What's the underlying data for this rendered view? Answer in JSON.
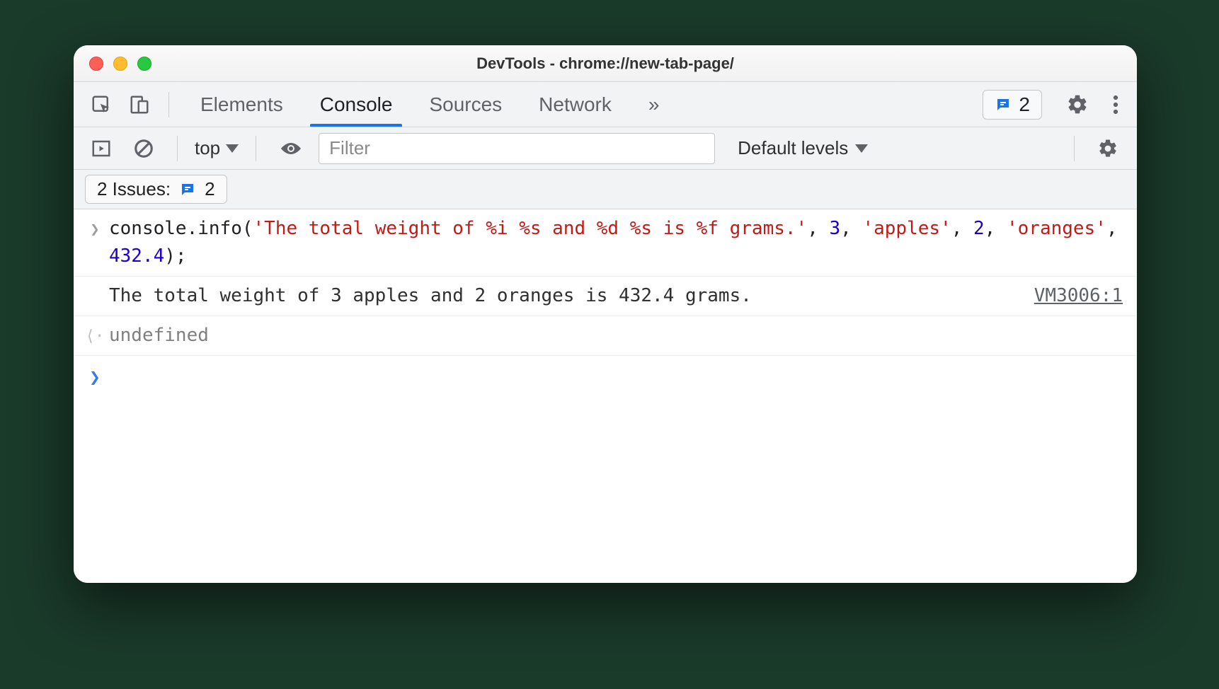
{
  "window": {
    "title": "DevTools - chrome://new-tab-page/"
  },
  "tabs": {
    "items": [
      "Elements",
      "Console",
      "Sources",
      "Network"
    ],
    "active_index": 1,
    "overflow_glyph": "»"
  },
  "header_issues": {
    "count": "2"
  },
  "toolbar": {
    "context": "top",
    "filter_placeholder": "Filter",
    "levels_label": "Default levels"
  },
  "issues_bar": {
    "label": "2 Issues:",
    "count": "2"
  },
  "console": {
    "input": {
      "tokens": [
        {
          "cls": "t-obj",
          "text": "console"
        },
        {
          "cls": "t-obj",
          "text": "."
        },
        {
          "cls": "t-obj",
          "text": "info"
        },
        {
          "cls": "t-obj",
          "text": "("
        },
        {
          "cls": "t-str",
          "text": "'The total weight of %i %s and %d %s is %f grams.'"
        },
        {
          "cls": "t-obj",
          "text": ", "
        },
        {
          "cls": "t-num",
          "text": "3"
        },
        {
          "cls": "t-obj",
          "text": ", "
        },
        {
          "cls": "t-str",
          "text": "'apples'"
        },
        {
          "cls": "t-obj",
          "text": ", "
        },
        {
          "cls": "t-num",
          "text": "2"
        },
        {
          "cls": "t-obj",
          "text": ", "
        },
        {
          "cls": "t-str",
          "text": "'oranges'"
        },
        {
          "cls": "t-obj",
          "text": ", "
        },
        {
          "cls": "t-num",
          "text": "432.4"
        },
        {
          "cls": "t-obj",
          "text": ");"
        }
      ]
    },
    "output": {
      "text": "The total weight of 3 apples and 2 oranges is 432.4 grams.",
      "source": "VM3006:1"
    },
    "return": {
      "text": "undefined"
    }
  }
}
